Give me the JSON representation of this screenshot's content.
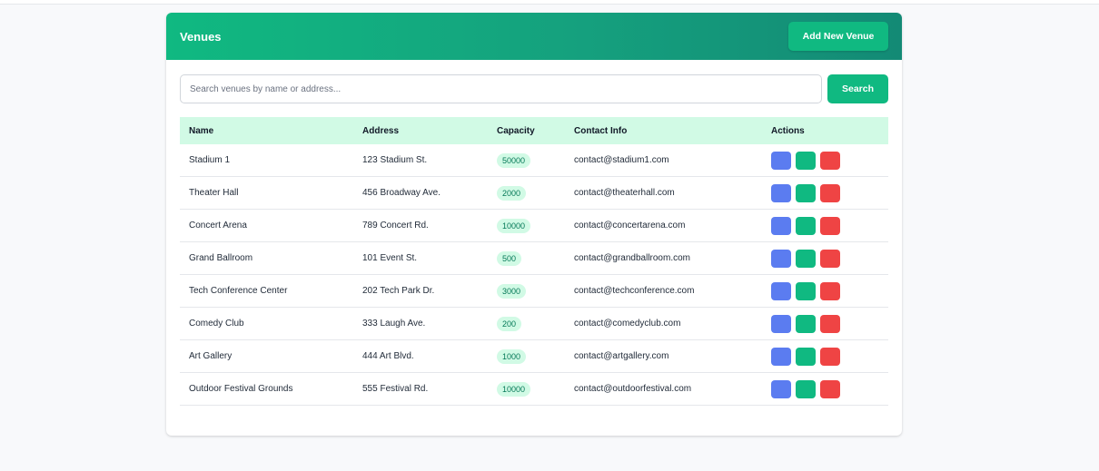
{
  "header": {
    "title": "Venues",
    "add_label": "Add New Venue"
  },
  "search": {
    "placeholder": "Search venues by name or address...",
    "value": "",
    "button_label": "Search"
  },
  "table": {
    "columns": [
      "Name",
      "Address",
      "Capacity",
      "Contact Info",
      "Actions"
    ],
    "rows": [
      {
        "name": "Stadium 1",
        "address": "123 Stadium St.",
        "capacity": "50000",
        "contact": "contact@stadium1.com"
      },
      {
        "name": "Theater Hall",
        "address": "456 Broadway Ave.",
        "capacity": "2000",
        "contact": "contact@theaterhall.com"
      },
      {
        "name": "Concert Arena",
        "address": "789 Concert Rd.",
        "capacity": "10000",
        "contact": "contact@concertarena.com"
      },
      {
        "name": "Grand Ballroom",
        "address": "101 Event St.",
        "capacity": "500",
        "contact": "contact@grandballroom.com"
      },
      {
        "name": "Tech Conference Center",
        "address": "202 Tech Park Dr.",
        "capacity": "3000",
        "contact": "contact@techconference.com"
      },
      {
        "name": "Comedy Club",
        "address": "333 Laugh Ave.",
        "capacity": "200",
        "contact": "contact@comedyclub.com"
      },
      {
        "name": "Art Gallery",
        "address": "444 Art Blvd.",
        "capacity": "1000",
        "contact": "contact@artgallery.com"
      },
      {
        "name": "Outdoor Festival Grounds",
        "address": "555 Festival Rd.",
        "capacity": "10000",
        "contact": "contact@outdoorfestival.com"
      }
    ]
  },
  "action_buttons": [
    {
      "icon": "view-icon",
      "color": "#5b7cf0"
    },
    {
      "icon": "edit-icon",
      "color": "#10b981"
    },
    {
      "icon": "delete-icon",
      "color": "#ef4444"
    }
  ],
  "colors": {
    "accent": "#10b981",
    "header_row": "#d1fae5"
  }
}
